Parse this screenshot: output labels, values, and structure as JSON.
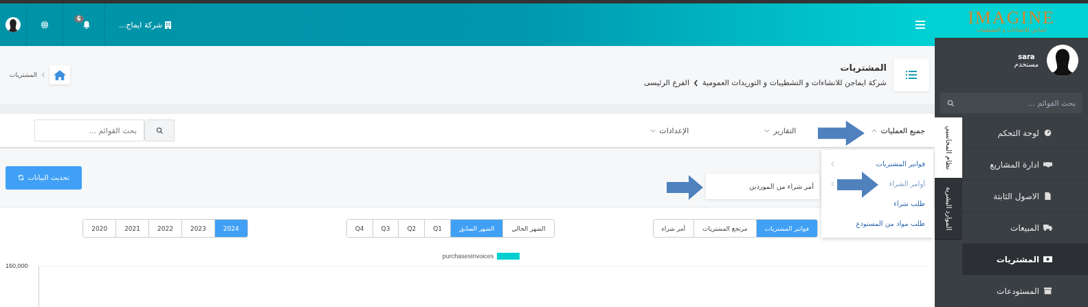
{
  "brand": {
    "logo": "IMAGINE",
    "tagline": "ايماجن للانشاءات و التشطيبات"
  },
  "user": {
    "name": "sara",
    "role": "مستخدم"
  },
  "sidebar_search": {
    "placeholder": "بحث القوائم ..."
  },
  "sidebar_items": [
    {
      "label": "لوحة التحكم",
      "kind": "dashboard",
      "selected": false
    },
    {
      "label": "ادارة المشاريع",
      "kind": "handshake",
      "selected": false
    },
    {
      "label": "الاصول الثابتة",
      "kind": "file",
      "selected": false
    },
    {
      "label": "المبيعات",
      "kind": "truck",
      "selected": false
    },
    {
      "label": "المشتريات",
      "kind": "money",
      "selected": true
    },
    {
      "label": "المستودعات",
      "kind": "archive",
      "selected": false
    }
  ],
  "system_tabs": [
    {
      "label": "نظام المحاسبي",
      "selected": true
    },
    {
      "label": "الموارد البشرية",
      "selected": false
    }
  ],
  "topbar": {
    "company": "شركة ايماج...",
    "notifications": "6"
  },
  "page": {
    "title": "المشتريات",
    "company": "شركة ايماجن للانشاءات و التشطيبات و التوريدات العمومية",
    "branch": "الفرع الرئيسى",
    "trail": "المشتريات"
  },
  "nav": [
    {
      "label": "جميع العمليات",
      "expanded": true
    },
    {
      "label": "التقارير",
      "expanded": false
    },
    {
      "label": "الإعدادات",
      "expanded": false
    }
  ],
  "nav_search": {
    "placeholder": "بحث القوائم ..."
  },
  "dropdown": [
    {
      "label": "فواتير المشتريات",
      "has_submenu": true,
      "open": false
    },
    {
      "label": "أوامر الشراء",
      "has_submenu": true,
      "open": true
    },
    {
      "label": "طلب شراء",
      "has_submenu": false,
      "open": false
    },
    {
      "label": "طلب مواد من المستودع",
      "has_submenu": false,
      "open": false
    }
  ],
  "submenu": [
    {
      "label": "أمر شراء من الموردين"
    }
  ],
  "refresh_button": "تحديث البيانات",
  "filter_groups": [
    [
      {
        "label": "فواتير المشتريات",
        "selected": true
      },
      {
        "label": "مرتجع المشتريات",
        "selected": false
      },
      {
        "label": "أمر شراء",
        "selected": false
      }
    ],
    [
      {
        "label": "الشهر الحالي",
        "selected": false
      },
      {
        "label": "الشهر السابق",
        "selected": true
      },
      {
        "label": "Q1",
        "selected": false
      },
      {
        "label": "Q2",
        "selected": false
      },
      {
        "label": "Q3",
        "selected": false
      },
      {
        "label": "Q4",
        "selected": false
      }
    ],
    [
      {
        "label": "2024",
        "selected": true
      },
      {
        "label": "2023",
        "selected": false
      },
      {
        "label": "2022",
        "selected": false
      },
      {
        "label": "2021",
        "selected": false
      },
      {
        "label": "2020",
        "selected": false
      }
    ]
  ],
  "chart": {
    "legend": [
      {
        "label": "purchasesInvoices",
        "color": "#00cfcf"
      }
    ],
    "y_ticks": [
      "160,000"
    ]
  }
}
